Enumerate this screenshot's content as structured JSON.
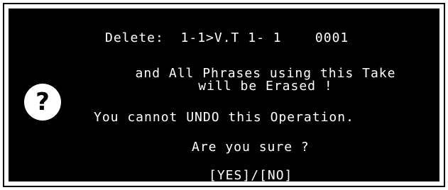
{
  "dialog": {
    "icon": "question-mark-icon",
    "line1": "Delete:  1-1>V.T 1- 1    0001",
    "line2": "and All Phrases using this Take",
    "line3": "will be Erased !",
    "line4": "You cannot UNDO this Operation.",
    "line5": "Are you sure ?",
    "buttons": {
      "yes": "[YES]",
      "separator": "/",
      "no": "[NO]"
    }
  },
  "colors": {
    "panel_background": "#000000",
    "text": "#ffffff",
    "frame": "#000000"
  }
}
